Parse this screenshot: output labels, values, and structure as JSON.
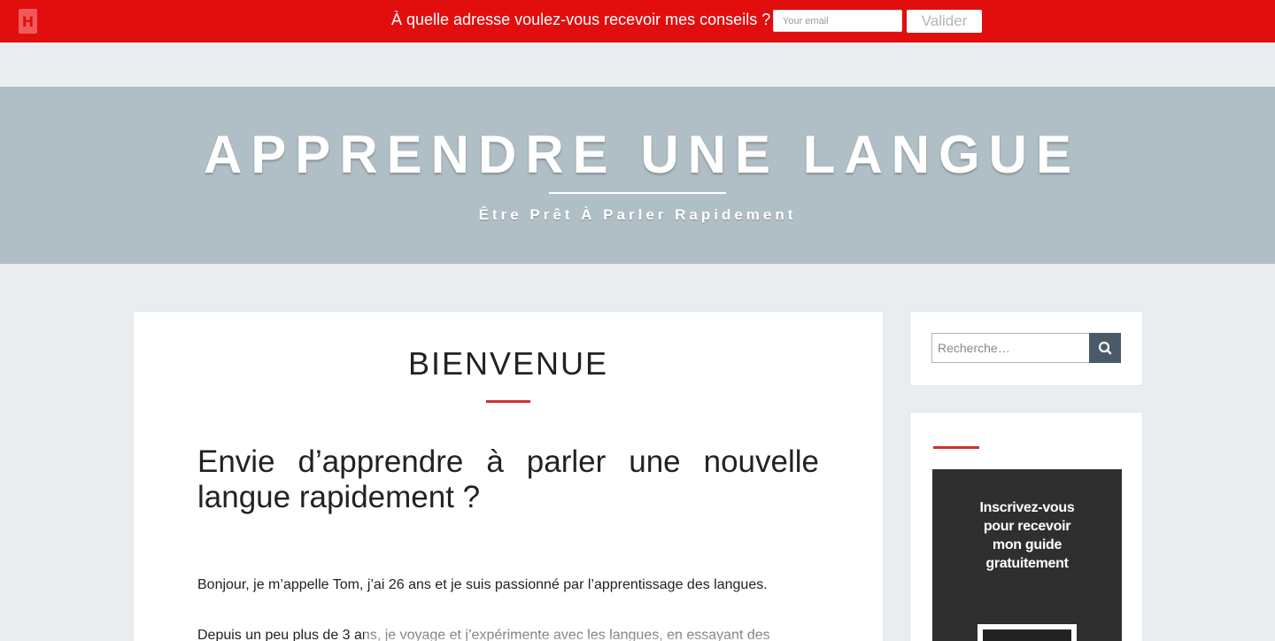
{
  "topbar": {
    "logo_letter": "H",
    "prompt": "À quelle adresse voulez-vous recevoir mes conseils ?",
    "email_placeholder": "Your email",
    "submit_label": "Valider",
    "background": "#e20e0e"
  },
  "header": {
    "site_title": "APPRENDRE UNE LANGUE",
    "tagline": "Être Prêt À Parler Rapidement",
    "background": "#b0bec5"
  },
  "main": {
    "page_title": "BIENVENUE",
    "accent": "#d32f2f",
    "subtitle": "Envie d’apprendre à parler une nouvelle langue rapidement ?",
    "paragraphs": [
      "Bonjour, je m’appelle Tom, j’ai 26 ans et je suis passionné par l’apprentissage des langues.",
      "Depuis un peu plus de 3 ans, je voyage et j’expérimente avec les langues, en essayant des"
    ]
  },
  "sidebar": {
    "search_placeholder": "Recherche…",
    "search_icon": "search-icon",
    "optin_text": "Inscrivez-vous pour recevoir mon guide gratuitement"
  }
}
